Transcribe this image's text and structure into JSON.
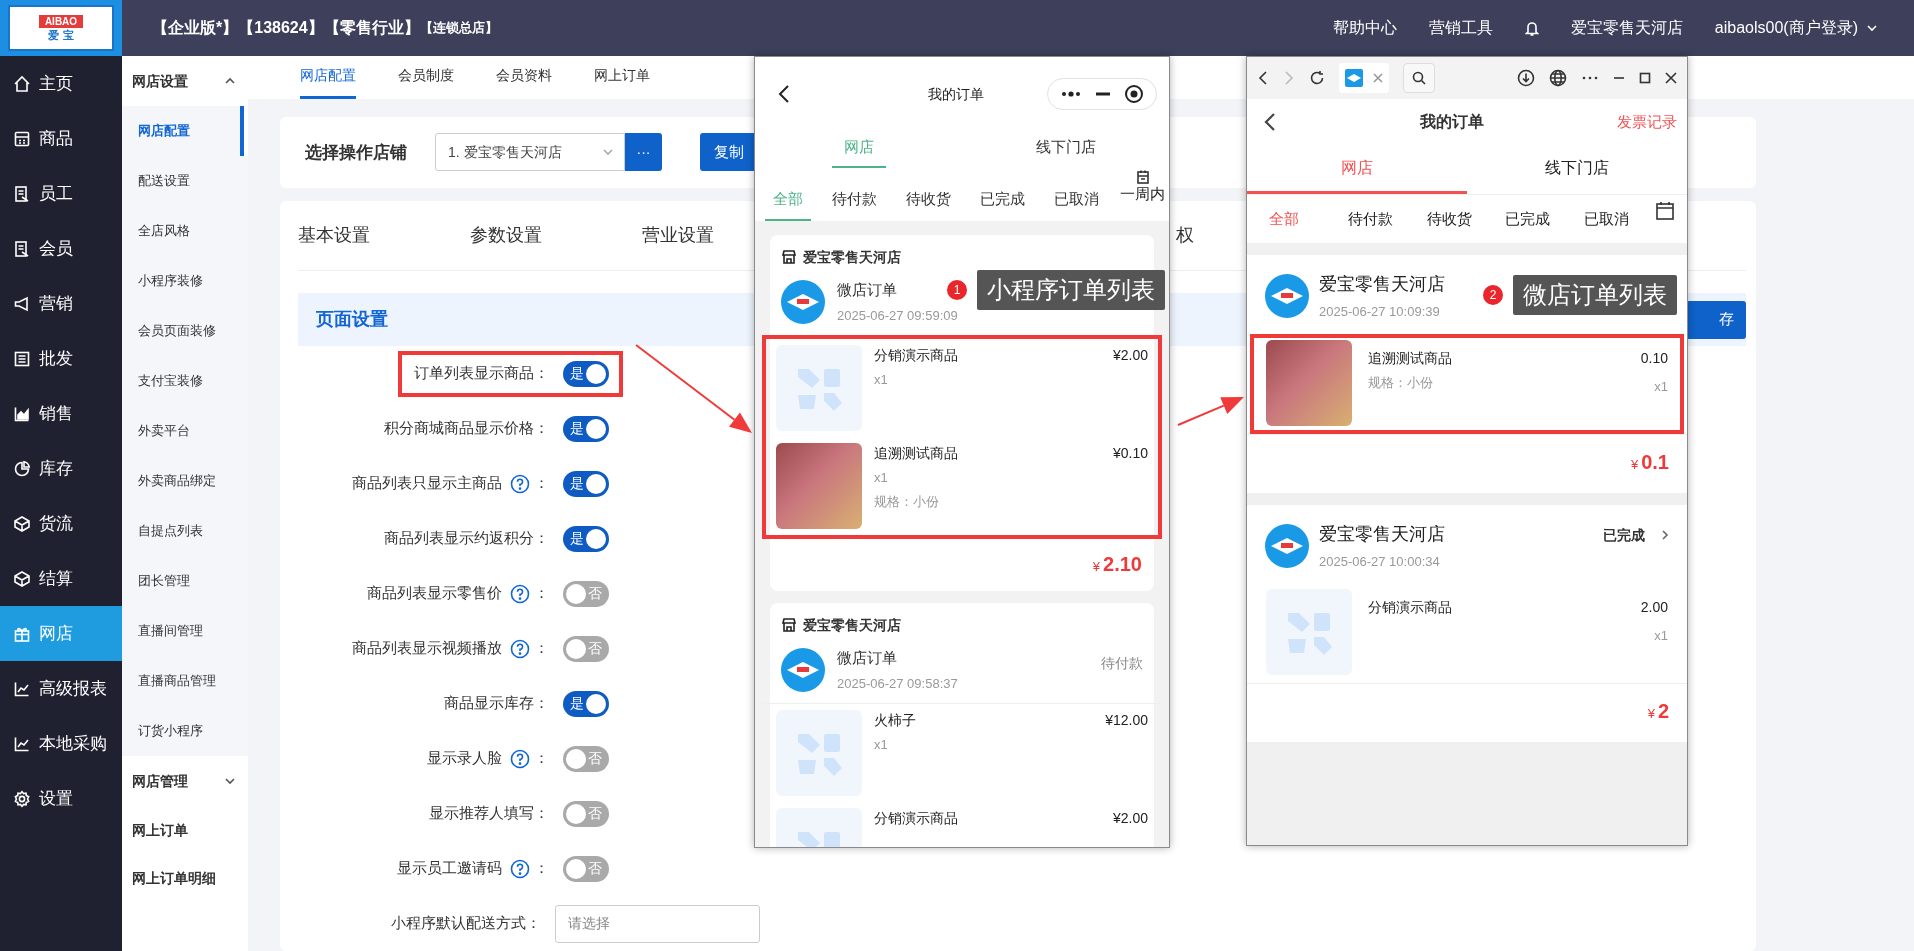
{
  "topbar": {
    "logo_en": "AIBAO",
    "logo_cn": "爱 宝",
    "edition": "【企业版*】【138624】【零售行业】",
    "branch": "【连锁总店】",
    "links": [
      "帮助中心",
      "营销工具"
    ],
    "store": "爱宝零售天河店",
    "user": "aibaols00(商户登录)"
  },
  "sidebar": [
    {
      "label": "主页",
      "selected": false
    },
    {
      "label": "商品",
      "selected": false
    },
    {
      "label": "员工",
      "selected": false
    },
    {
      "label": "会员",
      "selected": false
    },
    {
      "label": "营销",
      "selected": false
    },
    {
      "label": "批发",
      "selected": false
    },
    {
      "label": "销售",
      "selected": false
    },
    {
      "label": "库存",
      "selected": false
    },
    {
      "label": "货流",
      "selected": false
    },
    {
      "label": "结算",
      "selected": false
    },
    {
      "label": "网店",
      "selected": true
    },
    {
      "label": "高级报表",
      "selected": false
    },
    {
      "label": "本地采购",
      "selected": false
    },
    {
      "label": "设置",
      "selected": false
    }
  ],
  "subnav": [
    {
      "kind": "group",
      "label": "网店设置",
      "expanded": true,
      "children": [
        {
          "label": "网店配置",
          "selected": true
        },
        {
          "label": "配送设置",
          "selected": false
        },
        {
          "label": "全店风格",
          "selected": false
        },
        {
          "label": "小程序装修",
          "selected": false
        },
        {
          "label": "会员页面装修",
          "selected": false
        },
        {
          "label": "支付宝装修",
          "selected": false
        },
        {
          "label": "外卖平台",
          "selected": false
        },
        {
          "label": "外卖商品绑定",
          "selected": false
        },
        {
          "label": "自提点列表",
          "selected": false
        },
        {
          "label": "团长管理",
          "selected": false
        },
        {
          "label": "直播间管理",
          "selected": false
        },
        {
          "label": "直播商品管理",
          "selected": false
        },
        {
          "label": "订货小程序",
          "selected": false
        }
      ]
    },
    {
      "kind": "group",
      "label": "网店管理",
      "expanded": false
    },
    {
      "kind": "link",
      "label": "网上订单"
    },
    {
      "kind": "link",
      "label": "网上订单明细"
    }
  ],
  "main_tabs": [
    {
      "label": "网店配置",
      "selected": true
    },
    {
      "label": "会员制度",
      "selected": false
    },
    {
      "label": "会员资料",
      "selected": false
    },
    {
      "label": "网上订单",
      "selected": false
    }
  ],
  "store_picker": {
    "label": "选择操作店铺",
    "value": "1. 爱宝零售天河店",
    "more": "···",
    "copy": "复制"
  },
  "settings": {
    "tabs": [
      "基本设置",
      "参数设置",
      "营业设置"
    ],
    "tab_partial": "权",
    "section": "页面设置",
    "save_partial": "存",
    "rows": [
      {
        "kind": "switch",
        "label": "订单列表显示商品：",
        "help": false,
        "on": true,
        "switch_text": "是",
        "highlighted": true
      },
      {
        "kind": "switch",
        "label": "积分商城商品显示价格：",
        "help": false,
        "on": true,
        "switch_text": "是",
        "highlighted": false
      },
      {
        "kind": "switch",
        "label": "商品列表只显示主商品",
        "help": true,
        "colon": "：",
        "on": true,
        "switch_text": "是",
        "highlighted": false
      },
      {
        "kind": "switch",
        "label": "商品列表显示约返积分：",
        "help": false,
        "on": true,
        "switch_text": "是",
        "highlighted": false
      },
      {
        "kind": "switch",
        "label": "商品列表显示零售价",
        "help": true,
        "colon": "：",
        "on": false,
        "switch_text": "否",
        "highlighted": false
      },
      {
        "kind": "switch",
        "label": "商品列表显示视频播放",
        "help": true,
        "colon": "：",
        "on": false,
        "switch_text": "否",
        "highlighted": false
      },
      {
        "kind": "switch",
        "label": "商品显示库存：",
        "help": false,
        "on": true,
        "switch_text": "是",
        "highlighted": false
      },
      {
        "kind": "switch",
        "label": "显示录人脸",
        "help": true,
        "colon": "：",
        "on": false,
        "switch_text": "否",
        "highlighted": false
      },
      {
        "kind": "switch",
        "label": "显示推荐人填写：",
        "help": false,
        "on": false,
        "switch_text": "否",
        "highlighted": false
      },
      {
        "kind": "switch",
        "label": "显示员工邀请码",
        "help": true,
        "colon": "：",
        "on": false,
        "switch_text": "否",
        "highlighted": false
      },
      {
        "kind": "select",
        "label": "小程序默认配送方式：",
        "help": false,
        "placeholder": "请选择",
        "highlighted": false
      }
    ]
  },
  "mini_program": {
    "title": "我的订单",
    "tabs": [
      {
        "label": "网店",
        "selected": true
      },
      {
        "label": "线下门店",
        "selected": false
      }
    ],
    "filters": [
      {
        "label": "全部",
        "selected": true
      },
      {
        "label": "待付款",
        "selected": false
      },
      {
        "label": "待收货",
        "selected": false
      },
      {
        "label": "已完成",
        "selected": false
      },
      {
        "label": "已取消",
        "selected": false
      }
    ],
    "date_filter": "一周内",
    "orders": [
      {
        "store": "爱宝零售天河店",
        "type": "微店订单",
        "time": "2025-06-27 09:59:09",
        "highlighted": true,
        "items": [
          {
            "name": "分销演示商品",
            "price": "¥2.00",
            "qty": "x1",
            "kind": "placeholder"
          },
          {
            "name": "追溯测试商品",
            "price": "¥0.10",
            "qty": "x1",
            "spec": "规格：小份",
            "kind": "photo"
          }
        ],
        "currency": "¥",
        "total": "2.10"
      },
      {
        "store": "爱宝零售天河店",
        "type": "微店订单",
        "time": "2025-06-27 09:58:37",
        "status": "待付款",
        "highlighted": false,
        "items": [
          {
            "name": "火柿子",
            "price": "¥12.00",
            "qty": "x1",
            "kind": "placeholder"
          },
          {
            "name": "分销演示商品",
            "price": "¥2.00",
            "kind": "placeholder"
          }
        ]
      }
    ]
  },
  "web_shop": {
    "title": "我的订单",
    "link": "发票记录",
    "tabs": [
      {
        "label": "网店",
        "selected": true
      },
      {
        "label": "线下门店",
        "selected": false
      }
    ],
    "filters": [
      {
        "label": "全部",
        "selected": true
      },
      {
        "label": "待付款",
        "selected": false
      },
      {
        "label": "待收货",
        "selected": false
      },
      {
        "label": "已完成",
        "selected": false
      },
      {
        "label": "已取消",
        "selected": false
      }
    ],
    "orders": [
      {
        "store": "爱宝零售天河店",
        "time": "2025-06-27 10:09:39",
        "highlighted": true,
        "items": [
          {
            "name": "追溯测试商品",
            "price": "0.10",
            "spec": "规格：小份",
            "qty": "x1",
            "kind": "photo"
          }
        ],
        "currency": "¥",
        "total": "0.1"
      },
      {
        "store": "爱宝零售天河店",
        "time": "2025-06-27 10:00:34",
        "status": "已完成",
        "highlighted": false,
        "items": [
          {
            "name": "分销演示商品",
            "price": "2.00",
            "qty": "x1",
            "kind": "placeholder"
          }
        ],
        "currency": "¥",
        "total": "2"
      }
    ]
  },
  "annotations": [
    {
      "number": "1",
      "text": "小程序订单列表"
    },
    {
      "number": "2",
      "text": "微店订单列表"
    }
  ]
}
